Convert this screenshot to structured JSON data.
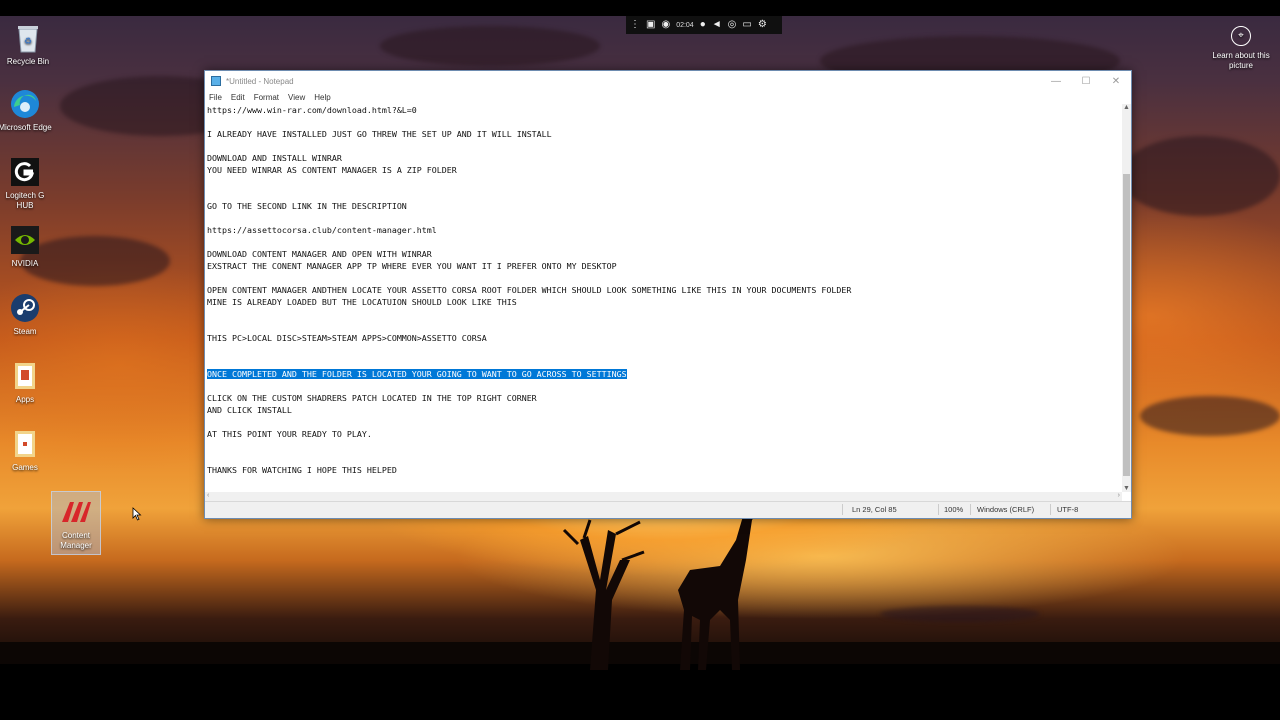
{
  "desktop": {
    "icons": [
      {
        "label": "Recycle Bin",
        "icon": "recycle-bin-icon"
      },
      {
        "label": "Microsoft Edge",
        "icon": "edge-icon"
      },
      {
        "label": "Logitech G HUB",
        "icon": "logitech-icon"
      },
      {
        "label": "NVIDIA",
        "icon": "nvidia-icon"
      },
      {
        "label": "Steam",
        "icon": "steam-icon"
      },
      {
        "label": "Apps",
        "icon": "folder-icon"
      },
      {
        "label": "Games",
        "icon": "folder-icon"
      },
      {
        "label": "Content Manager",
        "icon": "content-manager-icon"
      }
    ],
    "learn_label": "Learn about this picture"
  },
  "recorder": {
    "timer": "02:04"
  },
  "notepad": {
    "title": "*Untitled - Notepad",
    "menu": [
      "File",
      "Edit",
      "Format",
      "View",
      "Help"
    ],
    "text_before": "https://www.win-rar.com/download.html?&L=0\n\nI ALREADY HAVE INSTALLED JUST GO THREW THE SET UP AND IT WILL INSTALL\n\nDOWNLOAD AND INSTALL WINRAR\nYOU NEED WINRAR AS CONTENT MANAGER IS A ZIP FOLDER\n\n\nGO TO THE SECOND LINK IN THE DESCRIPTION\n\nhttps://assettocorsa.club/content-manager.html\n\nDOWNLOAD CONTENT MANAGER AND OPEN WITH WINRAR\nEXSTRACT THE CONENT MANAGER APP TP WHERE EVER YOU WANT IT I PREFER ONTO MY DESKTOP\n\nOPEN CONTENT MANAGER ANDTHEN LOCATE YOUR ASSETTO CORSA ROOT FOLDER WHICH SHOULD LOOK SOMETHING LIKE THIS IN YOUR DOCUMENTS FOLDER\nMINE IS ALREADY LOADED BUT THE LOCATUION SHOULD LOOK LIKE THIS\n\n\nTHIS PC>LOCAL DISC>STEAM>STEAM APPS>COMMON>ASSETTO CORSA\n\n\n",
    "text_selected": "ONCE COMPLETED AND THE FOLDER IS LOCATED YOUR GOING TO WANT TO GO ACROSS TO SETTINGS",
    "text_after": "\n\nCLICK ON THE CUSTOM SHADRERS PATCH LOCATED IN THE TOP RIGHT CORNER\nAND CLICK INSTALL\n\nAT THIS POINT YOUR READY TO PLAY.\n\n\nTHANKS FOR WATCHING I HOPE THIS HELPED",
    "status": {
      "position": "Ln 29, Col 85",
      "zoom": "100%",
      "line_ending": "Windows (CRLF)",
      "encoding": "UTF-8"
    }
  },
  "colors": {
    "selection": "#0078d7",
    "accent": "#0078d7"
  }
}
